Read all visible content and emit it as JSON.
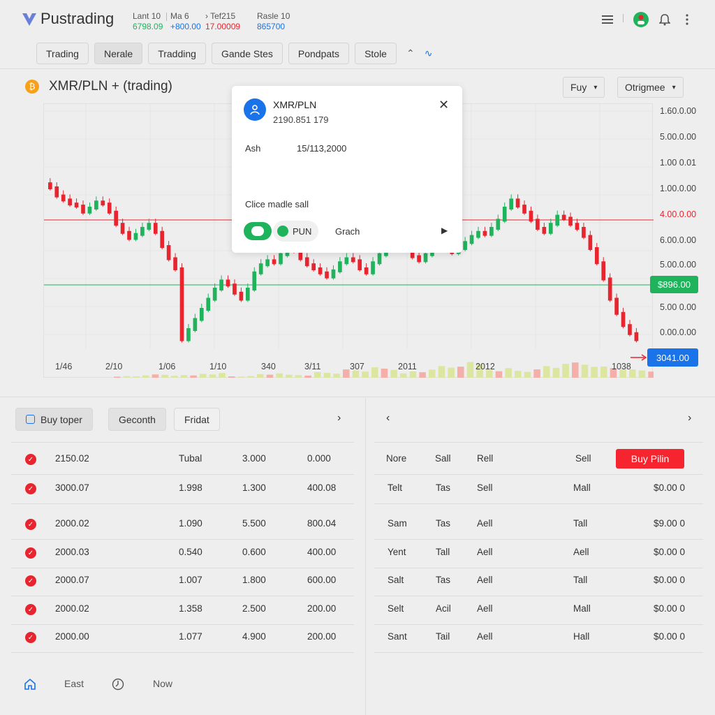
{
  "app": {
    "name": "Pustrading"
  },
  "tickers": [
    {
      "label": "Lant 10",
      "value": "6798.09",
      "color": "#1fb35c"
    },
    {
      "label": "Ma 6",
      "value": "+800.00",
      "color": "#1a73e8"
    },
    {
      "label": "Tef215",
      "value": "17.00009",
      "color": "#e8242f"
    },
    {
      "label": "Rasle 10",
      "value": "865700",
      "color": "#1a73e8"
    }
  ],
  "header_icons": [
    "menu-icon",
    "user-icon",
    "bell-icon",
    "more-icon"
  ],
  "tabs": [
    {
      "label": "Trading"
    },
    {
      "label": "Nerale"
    },
    {
      "label": "Tradding"
    },
    {
      "label": "Gande Stes"
    },
    {
      "label": "Pondpats"
    },
    {
      "label": "Stole"
    }
  ],
  "pair": {
    "title": "XMR/PLN + (trading)"
  },
  "selects": {
    "type": "Fuy",
    "option": "Otrigmee"
  },
  "y_labels": [
    "1.60.0.00",
    "5.00.0.00",
    "1.00 0.01",
    "1.00.0.00",
    "4.00.0.00",
    "6.00.0.00",
    "5.00.0.00",
    "5.00 0.00",
    "0.00.0.00"
  ],
  "x_labels": [
    "1/46",
    "2/10",
    "1/06",
    "1/10",
    "340",
    "3/11",
    "307",
    "2011",
    "2012",
    "1038"
  ],
  "price_tags": {
    "green": "$896.00",
    "blue": "3041.00"
  },
  "chart_data": {
    "type": "candlestick",
    "title": "XMR/PLN + (trading)",
    "y_labels": [
      "1.60.0.00",
      "5.00.0.00",
      "1.00 0.01",
      "1.00.0.00",
      "4.00.0.00",
      "6.00.0.00",
      "5.00.0.00",
      "5.00 0.00",
      "0.00.0.00"
    ],
    "x_labels": [
      "1/46",
      "2/10",
      "1/06",
      "1/10",
      "340",
      "3/11",
      "307",
      "2011",
      "2012",
      "1038"
    ],
    "reference_lines": [
      {
        "label": "4.00.0.00",
        "color": "#e8242f"
      },
      {
        "label": "$896.00",
        "color": "#1fb35c"
      }
    ],
    "close_series": [
      0.8,
      0.76,
      0.74,
      0.72,
      0.71,
      0.68,
      0.7,
      0.73,
      0.72,
      0.68,
      0.62,
      0.58,
      0.55,
      0.57,
      0.6,
      0.62,
      0.58,
      0.51,
      0.45,
      0.4,
      0.05,
      0.1,
      0.15,
      0.2,
      0.25,
      0.3,
      0.34,
      0.32,
      0.28,
      0.25,
      0.3,
      0.38,
      0.42,
      0.44,
      0.43,
      0.47,
      0.5,
      0.49,
      0.45,
      0.42,
      0.4,
      0.38,
      0.36,
      0.39,
      0.43,
      0.45,
      0.44,
      0.4,
      0.38,
      0.43,
      0.47,
      0.52,
      0.55,
      0.53,
      0.5,
      0.46,
      0.44,
      0.47,
      0.5,
      0.53,
      0.51,
      0.48,
      0.5,
      0.53,
      0.56,
      0.58,
      0.57,
      0.6,
      0.64,
      0.7,
      0.74,
      0.71,
      0.68,
      0.64,
      0.6,
      0.58,
      0.62,
      0.66,
      0.65,
      0.62,
      0.6,
      0.56,
      0.5,
      0.43,
      0.35,
      0.25,
      0.18,
      0.12,
      0.08,
      0.05
    ],
    "volume": [
      0.1,
      0.2,
      0.15,
      0.3,
      0.1,
      0.25,
      0.2,
      0.35,
      0.5,
      0.6,
      0.4,
      0.7,
      0.9,
      0.6,
      0.5,
      0.8,
      1.0,
      0.7,
      0.5,
      0.3
    ]
  },
  "popup": {
    "title": "XMR/PLN",
    "subtitle": "2190.851 179",
    "ask_label": "Ash",
    "ask_value": "15/113,2000",
    "mode_label": "Clice madle sall",
    "chip_label": "PUN",
    "graph_label": "Grach"
  },
  "left_panel": {
    "tabs": [
      "Buy toper",
      "Geconth",
      "Fridat"
    ],
    "rows": [
      [
        "2150.02",
        "Tubal",
        "3.000",
        "0.000"
      ],
      [
        "3000.07",
        "1.998",
        "1.300",
        "400.08"
      ],
      [
        "2000.02",
        "1.090",
        "5.500",
        "800.04"
      ],
      [
        "2000.03",
        "0.540",
        "0.600",
        "400.00"
      ],
      [
        "2000.07",
        "1.007",
        "1.800",
        "600.00"
      ],
      [
        "2000.02",
        "1.358",
        "2.500",
        "200.00"
      ],
      [
        "2000.00",
        "1.077",
        "4.900",
        "200.00"
      ]
    ]
  },
  "right_panel": {
    "headers": [
      "Nore",
      "Sall",
      "Rell",
      "Sell"
    ],
    "buy_label": "Buy Pilin",
    "rows": [
      [
        "Telt",
        "Tas",
        "Sell",
        "Mall",
        "$0.00 0"
      ],
      [
        "Sam",
        "Tas",
        "Aell",
        "Tall",
        "$9.00 0"
      ],
      [
        "Yent",
        "Tall",
        "Aell",
        "Aell",
        "$0.00 0"
      ],
      [
        "Salt",
        "Tas",
        "Aell",
        "Tall",
        "$0.00 0"
      ],
      [
        "Selt",
        "Acil",
        "Aell",
        "Mall",
        "$0.00 0"
      ],
      [
        "Sant",
        "Tail",
        "Aell",
        "Hall",
        "$0.00 0"
      ]
    ]
  },
  "footer": {
    "items": [
      "East",
      "Now"
    ]
  },
  "colors": {
    "green": "#1fb35c",
    "red": "#e8242f",
    "blue": "#1a73e8"
  }
}
